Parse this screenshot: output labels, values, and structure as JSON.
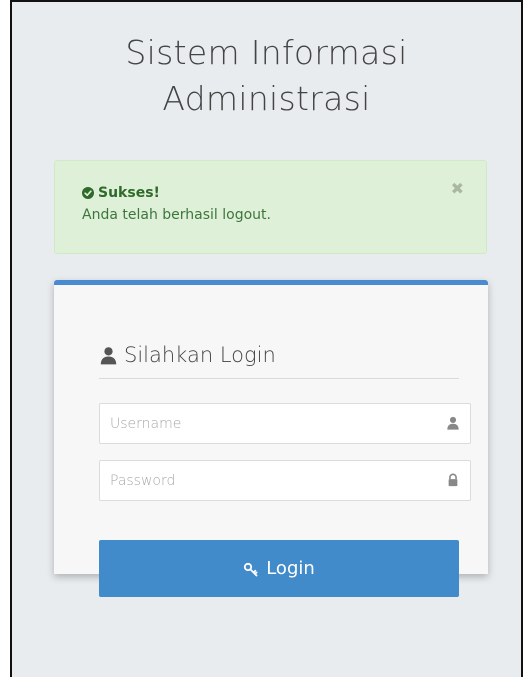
{
  "app": {
    "title_line1": "Sistem Informasi",
    "title_line2": "Administrasi"
  },
  "alert": {
    "heading": "Sukses!",
    "message": "Anda telah berhasil logout.",
    "close_symbol": "✖",
    "icon": "check-circle-icon",
    "color_bg": "#dff0d8",
    "color_text": "#3c763d"
  },
  "login_panel": {
    "heading": "Silahkan Login",
    "heading_icon": "user-icon",
    "accent_color": "#4a8ad0",
    "username": {
      "placeholder": "Username",
      "value": "",
      "icon": "user-icon"
    },
    "password": {
      "placeholder": "Password",
      "value": "",
      "icon": "lock-icon"
    },
    "submit_label": "Login",
    "submit_icon": "key-icon",
    "submit_color": "#428bca"
  }
}
